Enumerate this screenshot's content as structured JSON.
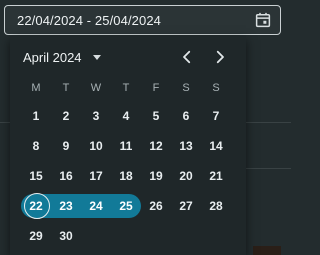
{
  "date_range": {
    "value": "22/04/2024 - 25/04/2024",
    "calendar_icon": "calendar-icon"
  },
  "picker": {
    "month_label": "April 2024",
    "dropdown_icon": "caret-down-icon",
    "prev_icon": "chevron-left-icon",
    "next_icon": "chevron-right-icon",
    "weekdays": [
      "M",
      "T",
      "W",
      "T",
      "F",
      "S",
      "S"
    ],
    "weeks": [
      [
        "1",
        "2",
        "3",
        "4",
        "5",
        "6",
        "7"
      ],
      [
        "8",
        "9",
        "10",
        "11",
        "12",
        "13",
        "14"
      ],
      [
        "15",
        "16",
        "17",
        "18",
        "19",
        "20",
        "21"
      ],
      [
        "22",
        "23",
        "24",
        "25",
        "26",
        "27",
        "28"
      ],
      [
        "29",
        "30"
      ]
    ],
    "range_start_day": 22,
    "range_end_day": 25,
    "accent_color": "#127a98"
  }
}
